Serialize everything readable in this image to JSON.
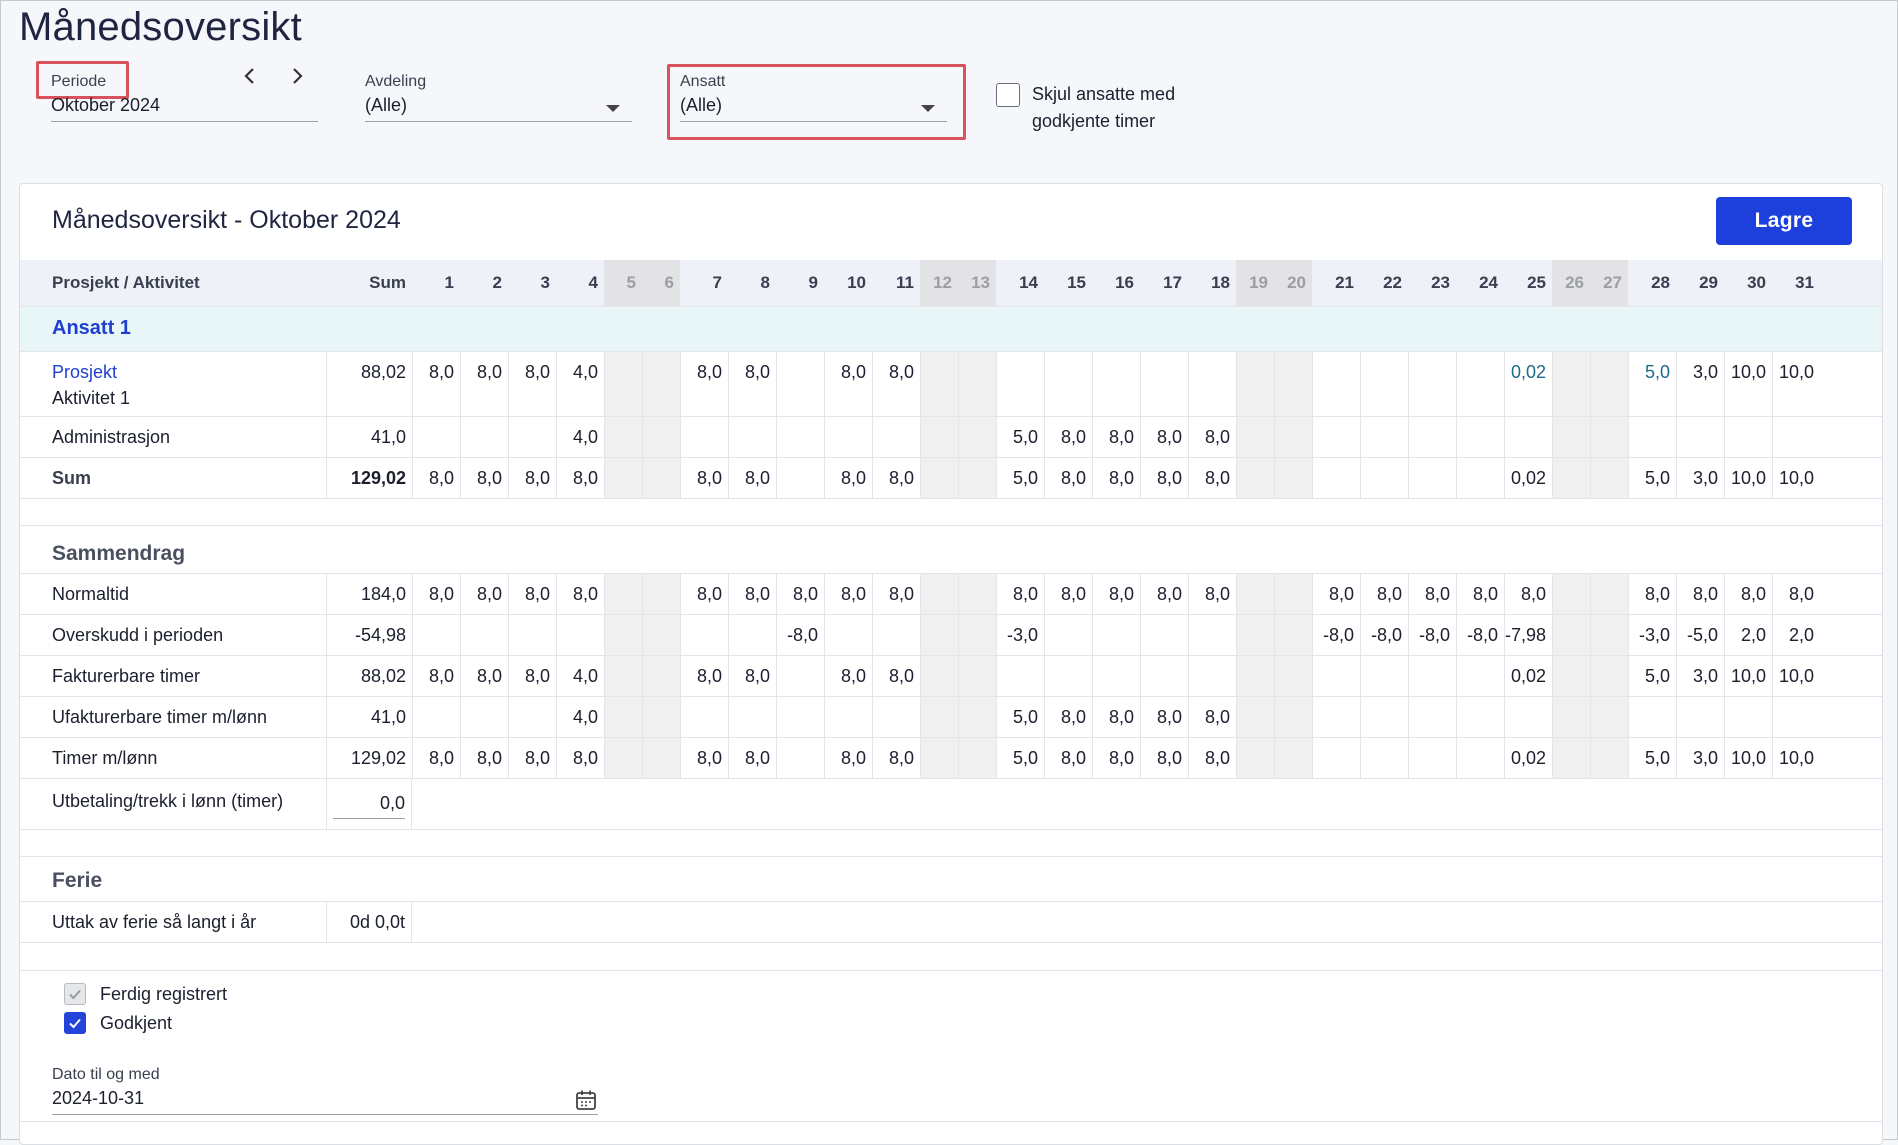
{
  "page_title": "Månedsoversikt",
  "filters": {
    "periode": {
      "label": "Periode",
      "value": "Oktober 2024",
      "prev_icon": "chevron-left-icon",
      "next_icon": "chevron-right-icon"
    },
    "avdeling": {
      "label": "Avdeling",
      "value": "(Alle)"
    },
    "ansatt": {
      "label": "Ansatt",
      "value": "(Alle)"
    },
    "skjul": {
      "label_line1": "Skjul ansatte med",
      "label_line2": "godkjente timer",
      "checked": false
    }
  },
  "card": {
    "title": "Månedsoversikt - Oktober 2024",
    "save_label": "Lagre"
  },
  "table": {
    "header_label": "Prosjekt / Aktivitet",
    "header_sum": "Sum",
    "days": [
      "1",
      "2",
      "3",
      "4",
      "5",
      "6",
      "7",
      "8",
      "9",
      "10",
      "11",
      "12",
      "13",
      "14",
      "15",
      "16",
      "17",
      "18",
      "19",
      "20",
      "21",
      "22",
      "23",
      "24",
      "25",
      "26",
      "27",
      "28",
      "29",
      "30",
      "31"
    ],
    "weekend_days": [
      5,
      6,
      12,
      13,
      19,
      20,
      26,
      27
    ],
    "employee": "Ansatt 1",
    "rows": [
      {
        "label": "Prosjekt",
        "sublabel": "Aktivitet 1",
        "sum": "88,02",
        "values": {
          "1": "8,0",
          "2": "8,0",
          "3": "8,0",
          "4": "4,0",
          "7": "8,0",
          "8": "8,0",
          "10": "8,0",
          "11": "8,0",
          "25": "0,02",
          "28": "5,0",
          "29": "3,0",
          "30": "10,0",
          "31": "10,0"
        }
      },
      {
        "label": "Administrasjon",
        "sum": "41,0",
        "values": {
          "4": "4,0",
          "14": "5,0",
          "15": "8,0",
          "16": "8,0",
          "17": "8,0",
          "18": "8,0"
        }
      },
      {
        "label": "Sum",
        "sum": "129,02",
        "values": {
          "1": "8,0",
          "2": "8,0",
          "3": "8,0",
          "4": "8,0",
          "7": "8,0",
          "8": "8,0",
          "10": "8,0",
          "11": "8,0",
          "14": "5,0",
          "15": "8,0",
          "16": "8,0",
          "17": "8,0",
          "18": "8,0",
          "25": "0,02",
          "28": "5,0",
          "29": "3,0",
          "30": "10,0",
          "31": "10,0"
        }
      }
    ]
  },
  "summary": {
    "title": "Sammendrag",
    "rows": [
      {
        "label": "Normaltid",
        "sum": "184,0",
        "values": {
          "1": "8,0",
          "2": "8,0",
          "3": "8,0",
          "4": "8,0",
          "7": "8,0",
          "8": "8,0",
          "9": "8,0",
          "10": "8,0",
          "11": "8,0",
          "14": "8,0",
          "15": "8,0",
          "16": "8,0",
          "17": "8,0",
          "18": "8,0",
          "21": "8,0",
          "22": "8,0",
          "23": "8,0",
          "24": "8,0",
          "25": "8,0",
          "28": "8,0",
          "29": "8,0",
          "30": "8,0",
          "31": "8,0"
        }
      },
      {
        "label": "Overskudd i perioden",
        "sum": "-54,98",
        "values": {
          "9": "-8,0",
          "14": "-3,0",
          "21": "-8,0",
          "22": "-8,0",
          "23": "-8,0",
          "24": "-8,0",
          "25": "-7,98",
          "28": "-3,0",
          "29": "-5,0",
          "30": "2,0",
          "31": "2,0"
        }
      },
      {
        "label": "Fakturerbare timer",
        "sum": "88,02",
        "values": {
          "1": "8,0",
          "2": "8,0",
          "3": "8,0",
          "4": "4,0",
          "7": "8,0",
          "8": "8,0",
          "10": "8,0",
          "11": "8,0",
          "25": "0,02",
          "28": "5,0",
          "29": "3,0",
          "30": "10,0",
          "31": "10,0"
        }
      },
      {
        "label": "Ufakturerbare timer m/lønn",
        "sum": "41,0",
        "values": {
          "4": "4,0",
          "14": "5,0",
          "15": "8,0",
          "16": "8,0",
          "17": "8,0",
          "18": "8,0"
        }
      },
      {
        "label": "Timer m/lønn",
        "sum": "129,02",
        "values": {
          "1": "8,0",
          "2": "8,0",
          "3": "8,0",
          "4": "8,0",
          "7": "8,0",
          "8": "8,0",
          "10": "8,0",
          "11": "8,0",
          "14": "5,0",
          "15": "8,0",
          "16": "8,0",
          "17": "8,0",
          "18": "8,0",
          "25": "0,02",
          "28": "5,0",
          "29": "3,0",
          "30": "10,0",
          "31": "10,0"
        }
      }
    ],
    "utbetaling": {
      "label": "Utbetaling/trekk i lønn (timer)",
      "value": "0,0"
    }
  },
  "ferie": {
    "title": "Ferie",
    "label": "Uttak av ferie så langt i år",
    "value": "0d 0,0t"
  },
  "status": {
    "ferdig": {
      "label": "Ferdig registrert",
      "checked": true
    },
    "godkjent": {
      "label": "Godkjent",
      "checked": true
    }
  },
  "dato": {
    "label": "Dato til og med",
    "value": "2024-10-31",
    "icon": "calendar-icon"
  },
  "colors": {
    "accent": "#1d3fdc",
    "highlight": "#d7525c",
    "link": "#1f3fd0",
    "employee_row_bg": "#e9f6f8"
  }
}
